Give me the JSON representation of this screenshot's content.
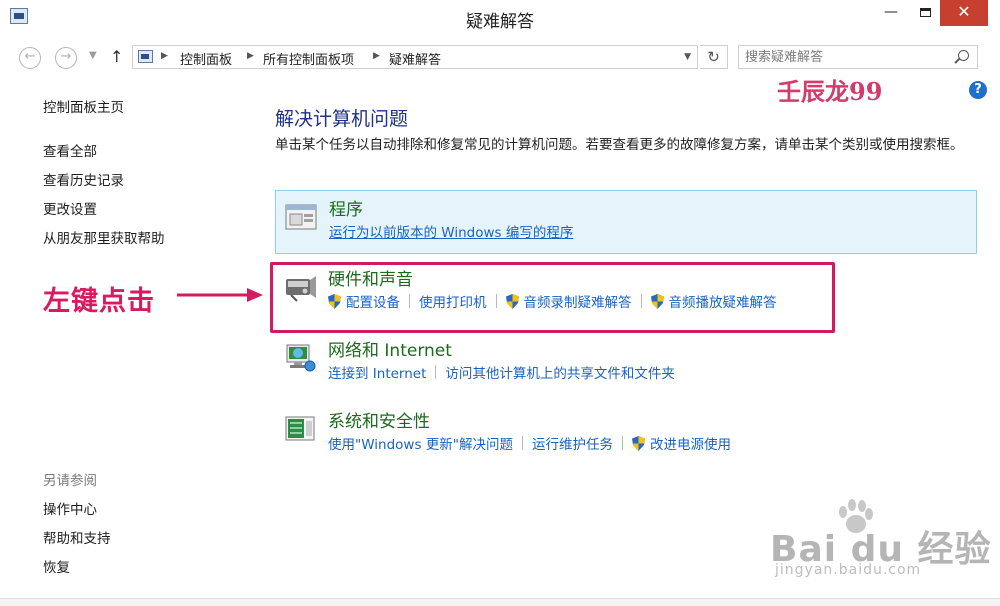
{
  "window": {
    "title": "疑难解答",
    "minimize_glyph": "—",
    "close_glyph": "✕"
  },
  "nav": {
    "back_glyph": "←",
    "forward_glyph": "→",
    "up_glyph": "↑",
    "breadcrumb": [
      "控制面板",
      "所有控制面板项",
      "疑难解答"
    ],
    "refresh_glyph": "↻",
    "search_placeholder": "搜索疑难解答"
  },
  "help_glyph": "?",
  "sidebar": {
    "home": "控制面板主页",
    "links": [
      "查看全部",
      "查看历史记录",
      "更改设置",
      "从朋友那里获取帮助"
    ],
    "see_also_heading": "另请参阅",
    "see_also": [
      "操作中心",
      "帮助和支持",
      "恢复"
    ]
  },
  "main": {
    "title": "解决计算机问题",
    "description": "单击某个任务以自动排除和修复常见的计算机问题。若要查看更多的故障修复方案，请单击某个类别或使用搜索框。",
    "categories": [
      {
        "title": "程序",
        "icon": "programs-icon",
        "links": [
          {
            "label": "运行为以前版本的 Windows 编写的程序",
            "shield": false
          }
        ]
      },
      {
        "title": "硬件和声音",
        "icon": "hardware-sound-icon",
        "links": [
          {
            "label": "配置设备",
            "shield": true
          },
          {
            "label": "使用打印机",
            "shield": false
          },
          {
            "label": "音频录制疑难解答",
            "shield": true
          },
          {
            "label": "音频播放疑难解答",
            "shield": true
          }
        ]
      },
      {
        "title": "网络和 Internet",
        "icon": "network-icon",
        "links": [
          {
            "label": "连接到 Internet",
            "shield": false
          },
          {
            "label": "访问其他计算机上的共享文件和文件夹",
            "shield": false
          }
        ]
      },
      {
        "title": "系统和安全性",
        "icon": "system-security-icon",
        "links": [
          {
            "label": "使用\"Windows 更新\"解决问题",
            "shield": false
          },
          {
            "label": "运行维护任务",
            "shield": false
          },
          {
            "label": "改进电源使用",
            "shield": true
          }
        ]
      }
    ]
  },
  "annotations": {
    "left_click": "左键点击",
    "author": "壬辰龙99",
    "baidu_logo": "Bai du 经验",
    "baidu_url": "jingyan.baidu.com"
  },
  "colors": {
    "highlight": "#d01a63",
    "link": "#1963c2",
    "category_title": "#1c6b1c",
    "heading": "#1e3287",
    "close_button": "#c7402f"
  }
}
